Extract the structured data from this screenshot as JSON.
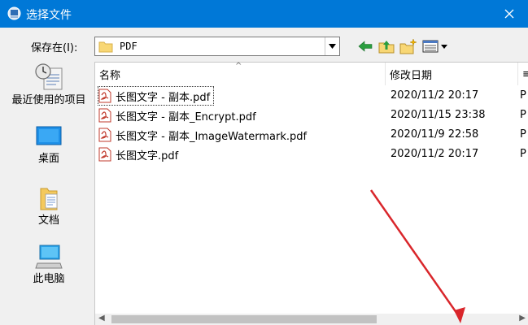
{
  "window": {
    "title": "选择文件",
    "accent": "#0078d7"
  },
  "location_bar": {
    "label": "保存在(I):",
    "current_folder": "PDF"
  },
  "places": [
    {
      "label": "最近使用的项目",
      "icon": "recent-places-icon"
    },
    {
      "label": "桌面",
      "icon": "desktop-icon"
    },
    {
      "label": "文档",
      "icon": "documents-icon"
    },
    {
      "label": "此电脑",
      "icon": "computer-icon"
    }
  ],
  "columns": {
    "name": "名称",
    "date": "修改日期",
    "more": "≡"
  },
  "files": [
    {
      "name": "长图文字 - 副本.pdf",
      "date": "2020/11/2 20:17",
      "more": "P",
      "selected": true
    },
    {
      "name": "长图文字 - 副本_Encrypt.pdf",
      "date": "2020/11/15 23:38",
      "more": "P",
      "selected": false
    },
    {
      "name": "长图文字 - 副本_ImageWatermark.pdf",
      "date": "2020/11/9 22:58",
      "more": "P",
      "selected": false
    },
    {
      "name": "长图文字.pdf",
      "date": "2020/11/2 20:17",
      "more": "P",
      "selected": false
    }
  ],
  "toolbar_icons": [
    "back-icon",
    "up-folder-icon",
    "new-folder-icon",
    "view-menu-icon"
  ],
  "annotation_color": "#d9262b"
}
